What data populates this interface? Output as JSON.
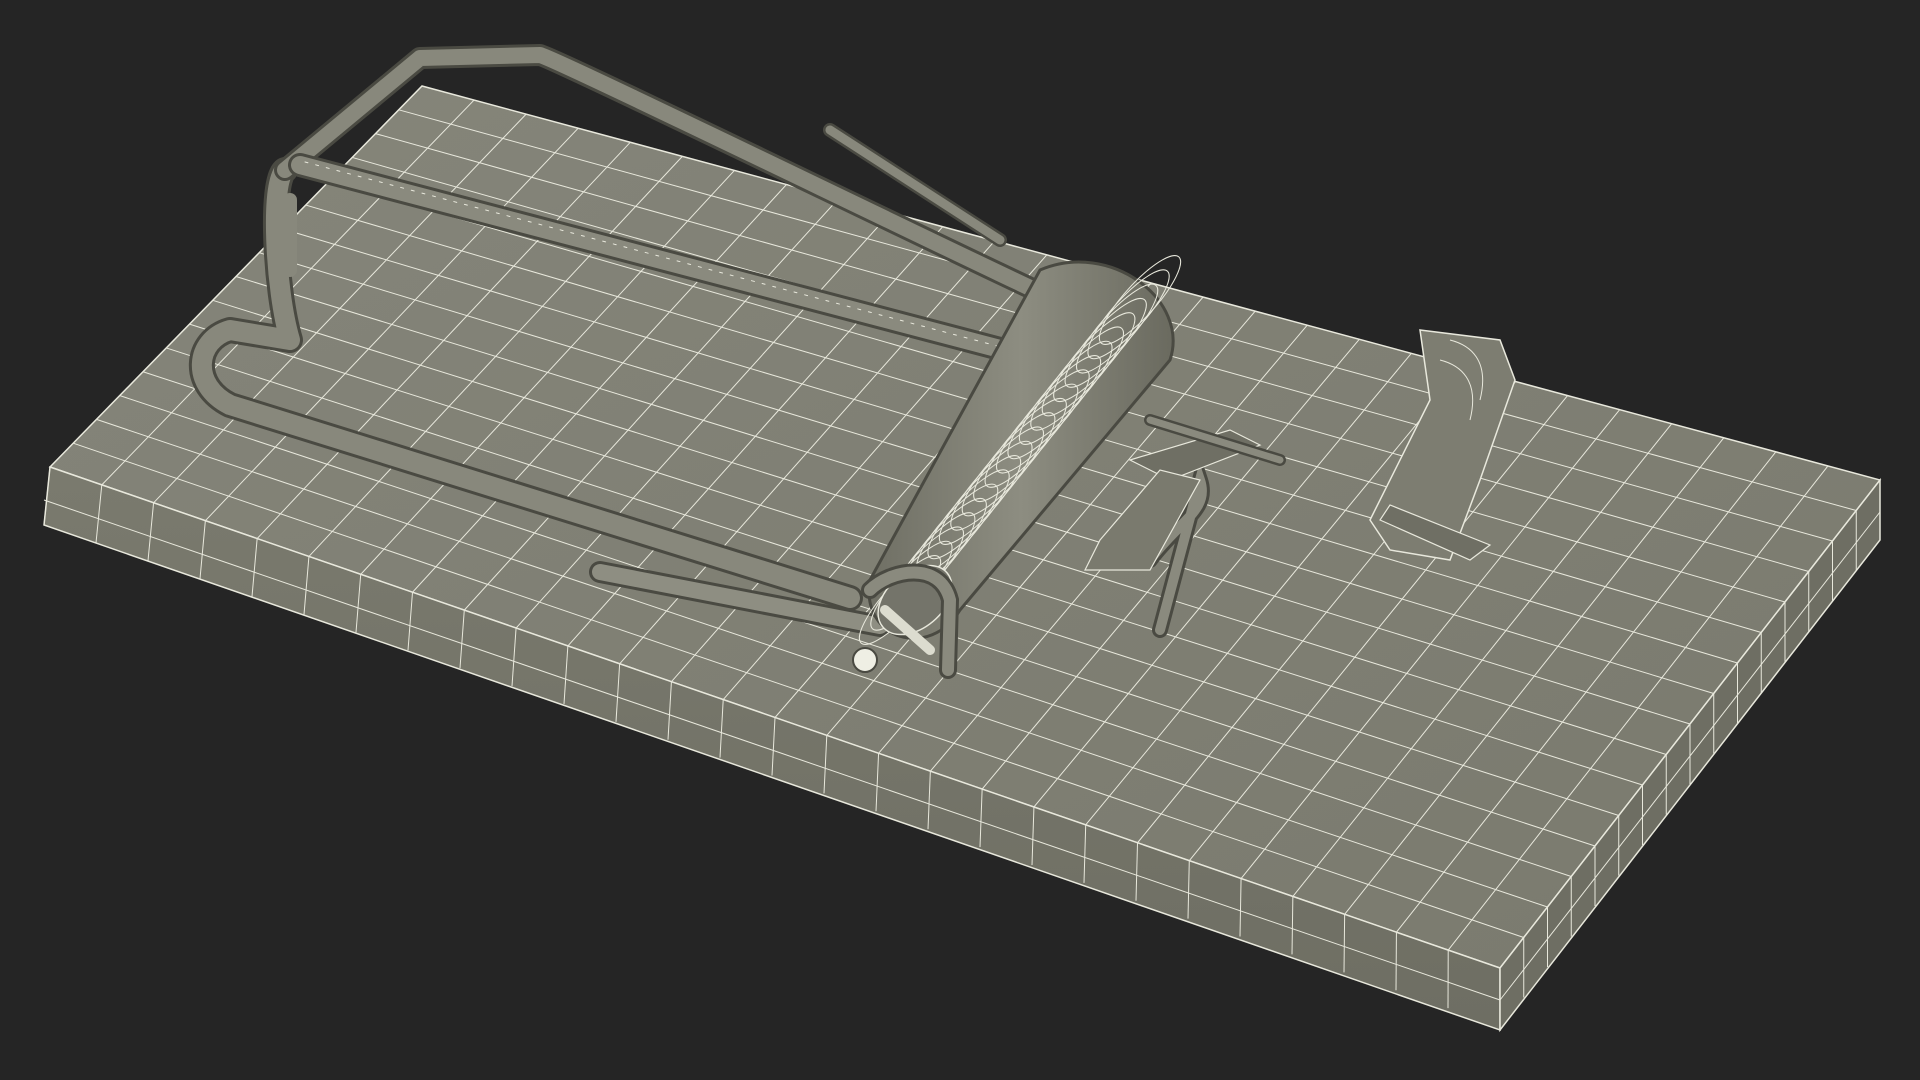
{
  "scene": {
    "subject": "mousetrap-wireframe-render",
    "colors": {
      "background": "#252525",
      "surface": "#7d7d71",
      "surface_light": "#8a8a7e",
      "surface_dark": "#6a6a5f",
      "side_face": "#747468",
      "wire": "#e8e8dc",
      "shadow": "#1a1a1a"
    },
    "objects": [
      {
        "name": "base-board",
        "kind": "wooden-base"
      },
      {
        "name": "kill-bar",
        "kind": "wire-loop"
      },
      {
        "name": "spring-coil",
        "kind": "torsion-spring"
      },
      {
        "name": "trigger-pedal",
        "kind": "bait-pedal"
      },
      {
        "name": "lock-bar",
        "kind": "arming-bar"
      },
      {
        "name": "staples",
        "kind": "mounting-staple"
      }
    ]
  }
}
